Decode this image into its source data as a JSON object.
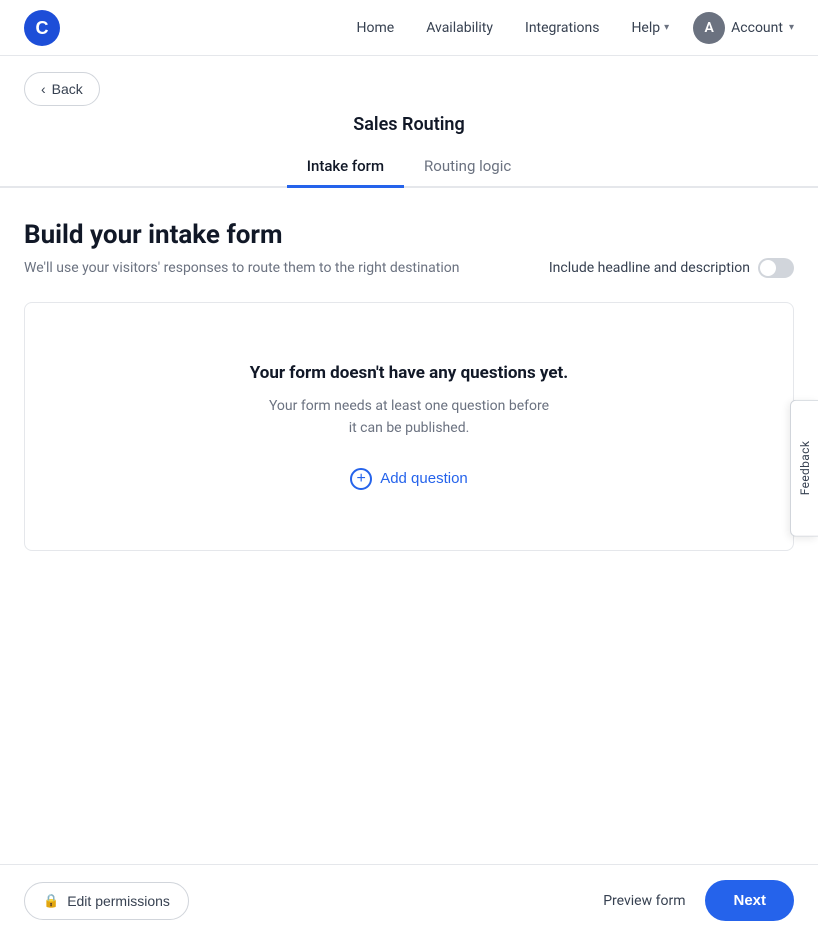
{
  "nav": {
    "logo_alt": "Chili Piper logo",
    "links": [
      "Home",
      "Availability",
      "Integrations"
    ],
    "help_label": "Help",
    "account_label": "Account",
    "avatar_letter": "A"
  },
  "back_button": {
    "label": "Back"
  },
  "page": {
    "title": "Sales Routing",
    "tabs": [
      {
        "label": "Intake form",
        "active": true
      },
      {
        "label": "Routing logic",
        "active": false
      }
    ]
  },
  "main": {
    "heading": "Build your intake form",
    "subheading": "We'll use your visitors' responses to route them to the right destination",
    "toggle_label": "Include headline and description",
    "form_card": {
      "title": "Your form doesn't have any questions yet.",
      "description_line1": "Your form needs at least one question before",
      "description_line2": "it can be published.",
      "add_question_label": "Add question"
    }
  },
  "feedback": {
    "label": "Feedback"
  },
  "bottom_bar": {
    "edit_permissions_label": "Edit permissions",
    "preview_form_label": "Preview form",
    "next_label": "Next"
  }
}
